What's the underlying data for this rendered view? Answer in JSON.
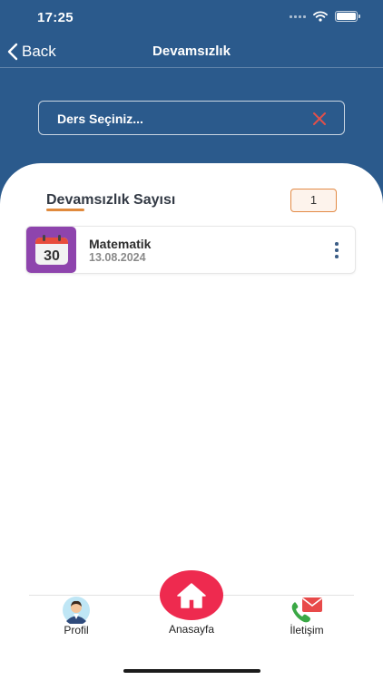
{
  "status_bar": {
    "time": "17:25"
  },
  "nav": {
    "back_label": "Back",
    "title": "Devamsızlık"
  },
  "course_select": {
    "placeholder": "Ders Seçiniz..."
  },
  "absence": {
    "title": "Devamsızlık Sayısı",
    "count": "1",
    "records": [
      {
        "subject": "Matematik",
        "date": "13.08.2024",
        "calendar_day": "30"
      }
    ]
  },
  "tab_bar": {
    "items": [
      {
        "label": "Profil",
        "icon": "profile-avatar-icon"
      },
      {
        "label": "Anasayfa",
        "icon": "home-icon"
      },
      {
        "label": "İletişim",
        "icon": "phone-mail-icon"
      }
    ]
  },
  "colors": {
    "header": "#2b5a8c",
    "accent_orange": "#e08a3c",
    "calendar_tile": "#8e44ad",
    "home_button": "#ee2a4f",
    "clear_icon": "#e2504a"
  }
}
